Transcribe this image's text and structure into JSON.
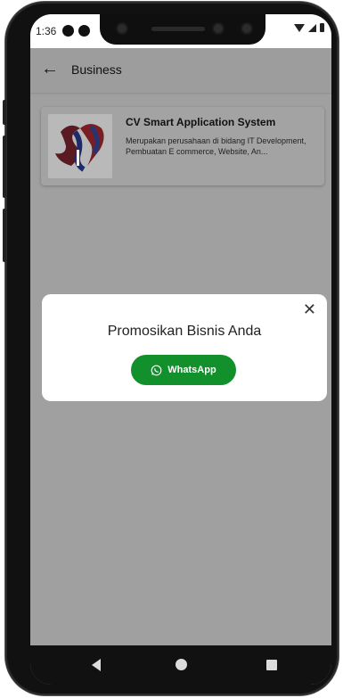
{
  "status_bar": {
    "time": "1:36"
  },
  "app_bar": {
    "title": "Business"
  },
  "business_card": {
    "name": "CV Smart Application System",
    "description": "Merupakan perusahaan di bidang IT Development,\nPembuatan E commerce, Website, An..."
  },
  "dialog": {
    "title": "Promosikan Bisnis Anda",
    "button_label": "WhatsApp"
  },
  "colors": {
    "scrim": "#a0a0a0",
    "whatsapp_green": "#12902c",
    "dialog_bg": "#ffffff",
    "nav_bg": "#111111"
  },
  "icons": [
    "back-arrow-icon",
    "close-icon",
    "whatsapp-icon",
    "nav-back-icon",
    "nav-home-icon",
    "nav-recents-icon"
  ]
}
